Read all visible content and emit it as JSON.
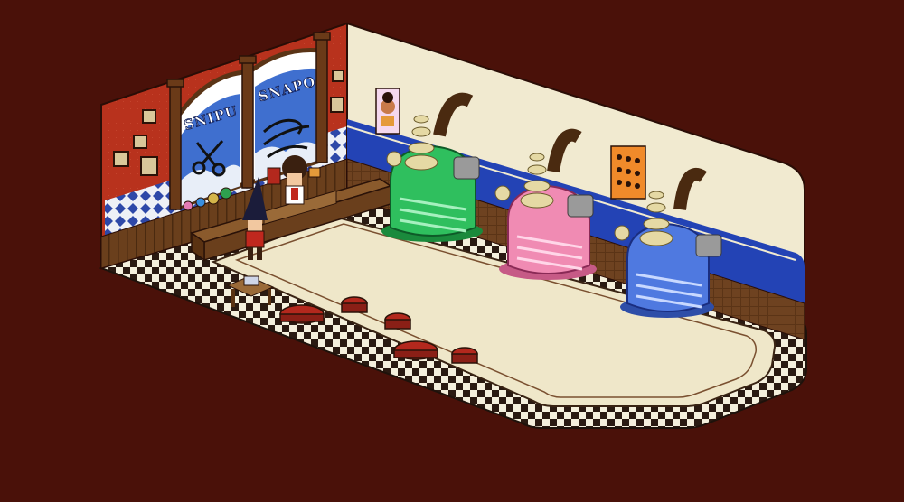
{
  "scene": {
    "title": "",
    "signs": {
      "left": "SNIPU",
      "right": "SNAPO"
    }
  },
  "colors": {
    "background": "#4a1109",
    "back_wall": "#b8321d",
    "side_wall": "#f1ead0",
    "wall_stripe": "#2343b5",
    "floor": "#efe7c9",
    "wood": "#7a4a22",
    "stool": "#b3281d",
    "dryer_green": "#2fbf5e",
    "dryer_pink": "#f08bb3",
    "dryer_blue": "#4f79e0",
    "chrome": "#e5d9a4"
  },
  "icons": {
    "scissors": "scissors-icon",
    "wind": "wind-icon",
    "hairstyle_chart": "hairstyle-chart-icon"
  },
  "characters": [
    {
      "name": "customer",
      "role": "visitor"
    },
    {
      "name": "barber",
      "role": "staff"
    }
  ],
  "hair_dryers": [
    {
      "color": "green"
    },
    {
      "color": "pink"
    },
    {
      "color": "blue"
    }
  ],
  "stools_count": 6
}
